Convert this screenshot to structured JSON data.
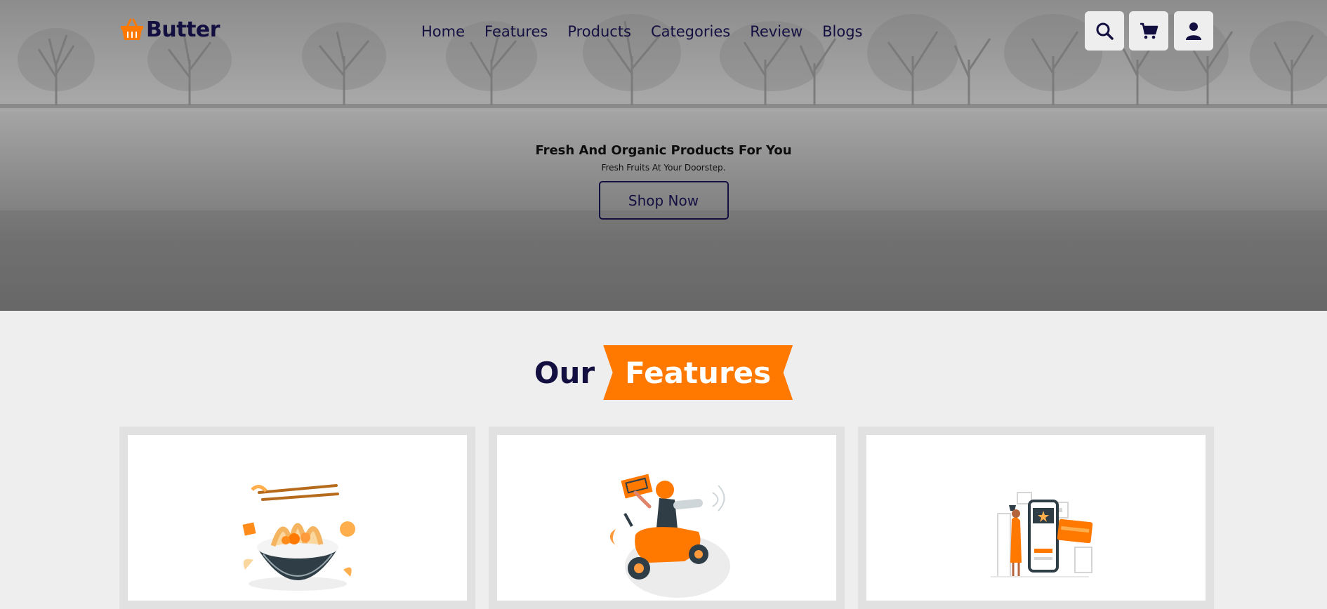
{
  "brand": {
    "name": "Butter",
    "icon": "shopping-basket-icon"
  },
  "nav": {
    "items": [
      "Home",
      "Features",
      "Products",
      "Categories",
      "Review",
      "Blogs"
    ]
  },
  "header_icons": [
    "search-icon",
    "cart-icon",
    "user-icon"
  ],
  "hero": {
    "title": "Fresh And Organic Products For You",
    "subtitle": "Fresh Fruits At Your Doorstep.",
    "button_label": "Shop Now"
  },
  "features": {
    "heading_plain": "Our",
    "heading_highlight": "Features",
    "cards": [
      {
        "illustration": "noodle-bowl-illustration"
      },
      {
        "illustration": "delivery-scooter-illustration"
      },
      {
        "illustration": "mobile-payment-illustration"
      }
    ]
  },
  "colors": {
    "accent": "#ff7800",
    "dark": "#130f40",
    "light_bg": "#eeeeee"
  }
}
